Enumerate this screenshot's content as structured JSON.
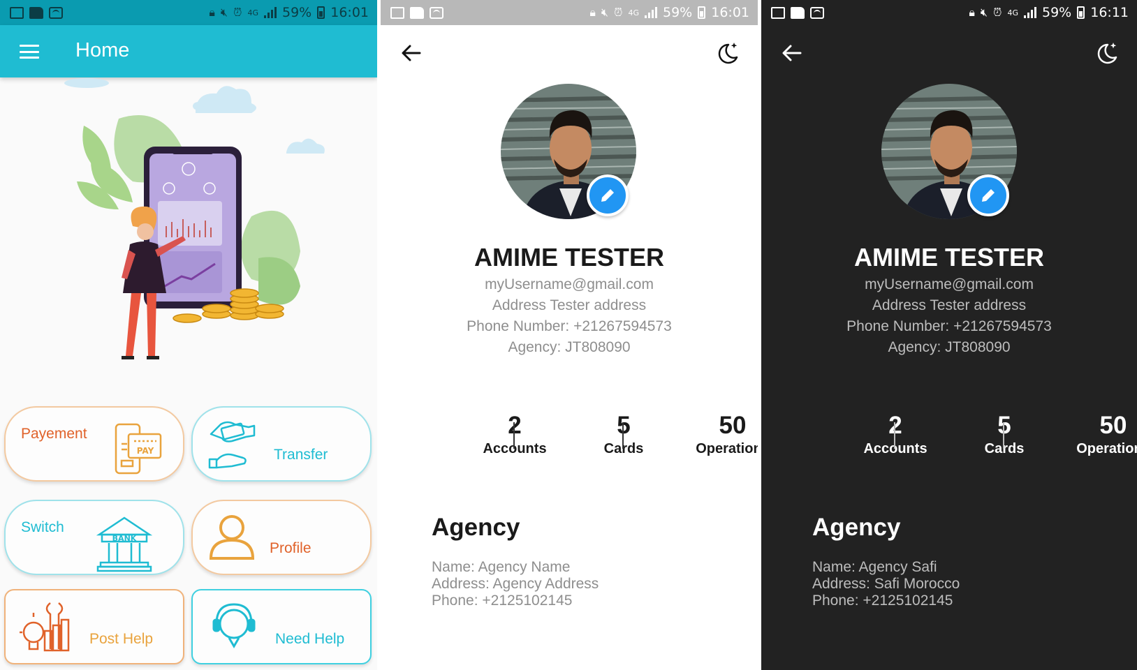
{
  "screen_home": {
    "status": {
      "battery": "59%",
      "time": "16:01",
      "network": "4G"
    },
    "appbar": {
      "title": "Home"
    },
    "tiles": [
      {
        "label": "Payement",
        "icon": "pay-card-icon"
      },
      {
        "label": "Transfer",
        "icon": "money-transfer-icon"
      },
      {
        "label": "Switch",
        "icon": "bank-icon",
        "icon_text": "BANK"
      },
      {
        "label": "Profile",
        "icon": "user-icon"
      },
      {
        "label": "Post Help",
        "icon": "tools-lightbulb-icon"
      },
      {
        "label": "Need Help",
        "icon": "headset-chat-icon"
      }
    ],
    "pay_icon_text": "PAY",
    "colors": {
      "appbar": "#1fbcd2",
      "statusbar": "#0a9bb0",
      "orange": "#e8702a",
      "cyan": "#1fbcd2",
      "gold": "#e9a33d"
    }
  },
  "profile_light": {
    "status": {
      "battery": "59%",
      "time": "16:01",
      "network": "4G"
    },
    "name": "AMIME TESTER",
    "email": "myUsername@gmail.com",
    "address": "Address Tester address",
    "phone": "Phone Number: +21267594573",
    "agency_code": "Agency: JT808090",
    "stats": [
      {
        "value": "2",
        "label": "Accounts"
      },
      {
        "value": "5",
        "label": "Cards"
      },
      {
        "value": "50",
        "label": "Operations"
      }
    ],
    "agency": {
      "title": "Agency",
      "name": "Name: Agency Name",
      "address": "Address: Agency Address",
      "phone": "Phone: +2125102145"
    }
  },
  "profile_dark": {
    "status": {
      "battery": "59%",
      "time": "16:11",
      "network": "4G"
    },
    "name": "AMIME TESTER",
    "email": "myUsername@gmail.com",
    "address": "Address Tester address",
    "phone": "Phone Number: +21267594573",
    "agency_code": "Agency: JT808090",
    "stats": [
      {
        "value": "2",
        "label": "Accounts"
      },
      {
        "value": "5",
        "label": "Cards"
      },
      {
        "value": "50",
        "label": "Operations"
      }
    ],
    "agency": {
      "title": "Agency",
      "name": "Name: Agency Safi",
      "address": "Address: Safi Morocco",
      "phone": "Phone: +2125102145"
    }
  },
  "accent": {
    "edit_fab": "#2196f3",
    "dark_bg": "#222222"
  }
}
